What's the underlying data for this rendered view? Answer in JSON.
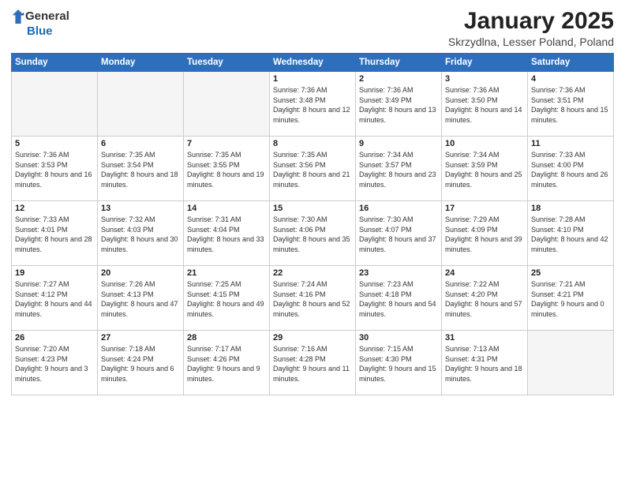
{
  "logo": {
    "general": "General",
    "blue": "Blue"
  },
  "title": "January 2025",
  "subtitle": "Skrzydlna, Lesser Poland, Poland",
  "days_header": [
    "Sunday",
    "Monday",
    "Tuesday",
    "Wednesday",
    "Thursday",
    "Friday",
    "Saturday"
  ],
  "weeks": [
    [
      {
        "day": "",
        "empty": true
      },
      {
        "day": "",
        "empty": true
      },
      {
        "day": "",
        "empty": true
      },
      {
        "day": "1",
        "sunrise": "Sunrise: 7:36 AM",
        "sunset": "Sunset: 3:48 PM",
        "daylight": "Daylight: 8 hours and 12 minutes."
      },
      {
        "day": "2",
        "sunrise": "Sunrise: 7:36 AM",
        "sunset": "Sunset: 3:49 PM",
        "daylight": "Daylight: 8 hours and 13 minutes."
      },
      {
        "day": "3",
        "sunrise": "Sunrise: 7:36 AM",
        "sunset": "Sunset: 3:50 PM",
        "daylight": "Daylight: 8 hours and 14 minutes."
      },
      {
        "day": "4",
        "sunrise": "Sunrise: 7:36 AM",
        "sunset": "Sunset: 3:51 PM",
        "daylight": "Daylight: 8 hours and 15 minutes."
      }
    ],
    [
      {
        "day": "5",
        "sunrise": "Sunrise: 7:36 AM",
        "sunset": "Sunset: 3:53 PM",
        "daylight": "Daylight: 8 hours and 16 minutes."
      },
      {
        "day": "6",
        "sunrise": "Sunrise: 7:35 AM",
        "sunset": "Sunset: 3:54 PM",
        "daylight": "Daylight: 8 hours and 18 minutes."
      },
      {
        "day": "7",
        "sunrise": "Sunrise: 7:35 AM",
        "sunset": "Sunset: 3:55 PM",
        "daylight": "Daylight: 8 hours and 19 minutes."
      },
      {
        "day": "8",
        "sunrise": "Sunrise: 7:35 AM",
        "sunset": "Sunset: 3:56 PM",
        "daylight": "Daylight: 8 hours and 21 minutes."
      },
      {
        "day": "9",
        "sunrise": "Sunrise: 7:34 AM",
        "sunset": "Sunset: 3:57 PM",
        "daylight": "Daylight: 8 hours and 23 minutes."
      },
      {
        "day": "10",
        "sunrise": "Sunrise: 7:34 AM",
        "sunset": "Sunset: 3:59 PM",
        "daylight": "Daylight: 8 hours and 25 minutes."
      },
      {
        "day": "11",
        "sunrise": "Sunrise: 7:33 AM",
        "sunset": "Sunset: 4:00 PM",
        "daylight": "Daylight: 8 hours and 26 minutes."
      }
    ],
    [
      {
        "day": "12",
        "sunrise": "Sunrise: 7:33 AM",
        "sunset": "Sunset: 4:01 PM",
        "daylight": "Daylight: 8 hours and 28 minutes."
      },
      {
        "day": "13",
        "sunrise": "Sunrise: 7:32 AM",
        "sunset": "Sunset: 4:03 PM",
        "daylight": "Daylight: 8 hours and 30 minutes."
      },
      {
        "day": "14",
        "sunrise": "Sunrise: 7:31 AM",
        "sunset": "Sunset: 4:04 PM",
        "daylight": "Daylight: 8 hours and 33 minutes."
      },
      {
        "day": "15",
        "sunrise": "Sunrise: 7:30 AM",
        "sunset": "Sunset: 4:06 PM",
        "daylight": "Daylight: 8 hours and 35 minutes."
      },
      {
        "day": "16",
        "sunrise": "Sunrise: 7:30 AM",
        "sunset": "Sunset: 4:07 PM",
        "daylight": "Daylight: 8 hours and 37 minutes."
      },
      {
        "day": "17",
        "sunrise": "Sunrise: 7:29 AM",
        "sunset": "Sunset: 4:09 PM",
        "daylight": "Daylight: 8 hours and 39 minutes."
      },
      {
        "day": "18",
        "sunrise": "Sunrise: 7:28 AM",
        "sunset": "Sunset: 4:10 PM",
        "daylight": "Daylight: 8 hours and 42 minutes."
      }
    ],
    [
      {
        "day": "19",
        "sunrise": "Sunrise: 7:27 AM",
        "sunset": "Sunset: 4:12 PM",
        "daylight": "Daylight: 8 hours and 44 minutes."
      },
      {
        "day": "20",
        "sunrise": "Sunrise: 7:26 AM",
        "sunset": "Sunset: 4:13 PM",
        "daylight": "Daylight: 8 hours and 47 minutes."
      },
      {
        "day": "21",
        "sunrise": "Sunrise: 7:25 AM",
        "sunset": "Sunset: 4:15 PM",
        "daylight": "Daylight: 8 hours and 49 minutes."
      },
      {
        "day": "22",
        "sunrise": "Sunrise: 7:24 AM",
        "sunset": "Sunset: 4:16 PM",
        "daylight": "Daylight: 8 hours and 52 minutes."
      },
      {
        "day": "23",
        "sunrise": "Sunrise: 7:23 AM",
        "sunset": "Sunset: 4:18 PM",
        "daylight": "Daylight: 8 hours and 54 minutes."
      },
      {
        "day": "24",
        "sunrise": "Sunrise: 7:22 AM",
        "sunset": "Sunset: 4:20 PM",
        "daylight": "Daylight: 8 hours and 57 minutes."
      },
      {
        "day": "25",
        "sunrise": "Sunrise: 7:21 AM",
        "sunset": "Sunset: 4:21 PM",
        "daylight": "Daylight: 9 hours and 0 minutes."
      }
    ],
    [
      {
        "day": "26",
        "sunrise": "Sunrise: 7:20 AM",
        "sunset": "Sunset: 4:23 PM",
        "daylight": "Daylight: 9 hours and 3 minutes."
      },
      {
        "day": "27",
        "sunrise": "Sunrise: 7:18 AM",
        "sunset": "Sunset: 4:24 PM",
        "daylight": "Daylight: 9 hours and 6 minutes."
      },
      {
        "day": "28",
        "sunrise": "Sunrise: 7:17 AM",
        "sunset": "Sunset: 4:26 PM",
        "daylight": "Daylight: 9 hours and 9 minutes."
      },
      {
        "day": "29",
        "sunrise": "Sunrise: 7:16 AM",
        "sunset": "Sunset: 4:28 PM",
        "daylight": "Daylight: 9 hours and 11 minutes."
      },
      {
        "day": "30",
        "sunrise": "Sunrise: 7:15 AM",
        "sunset": "Sunset: 4:30 PM",
        "daylight": "Daylight: 9 hours and 15 minutes."
      },
      {
        "day": "31",
        "sunrise": "Sunrise: 7:13 AM",
        "sunset": "Sunset: 4:31 PM",
        "daylight": "Daylight: 9 hours and 18 minutes."
      },
      {
        "day": "",
        "empty": true
      }
    ]
  ]
}
